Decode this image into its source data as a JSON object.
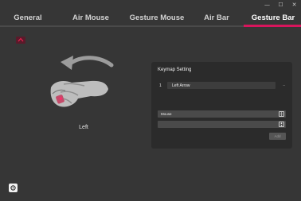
{
  "window_controls": {
    "minimize": "—",
    "maximize": "☐",
    "close": "✕"
  },
  "tabs": [
    {
      "label": "General"
    },
    {
      "label": "Air Mouse"
    },
    {
      "label": "Gesture Mouse"
    },
    {
      "label": "Air Bar"
    },
    {
      "label": "Gesture Bar",
      "active": true
    }
  ],
  "gesture": {
    "label": "Left",
    "icon": "hand-swipe-left-icon"
  },
  "keymap": {
    "title": "Keymap Setting",
    "entry_number": "1",
    "entry_value": "Left Arrow",
    "remove_glyph": "–",
    "type_select": "Mouse",
    "second_select": "",
    "add_label": "Add"
  },
  "colors": {
    "accent": "#d8155c",
    "background": "#363636",
    "panel": "#2b2b2b"
  }
}
